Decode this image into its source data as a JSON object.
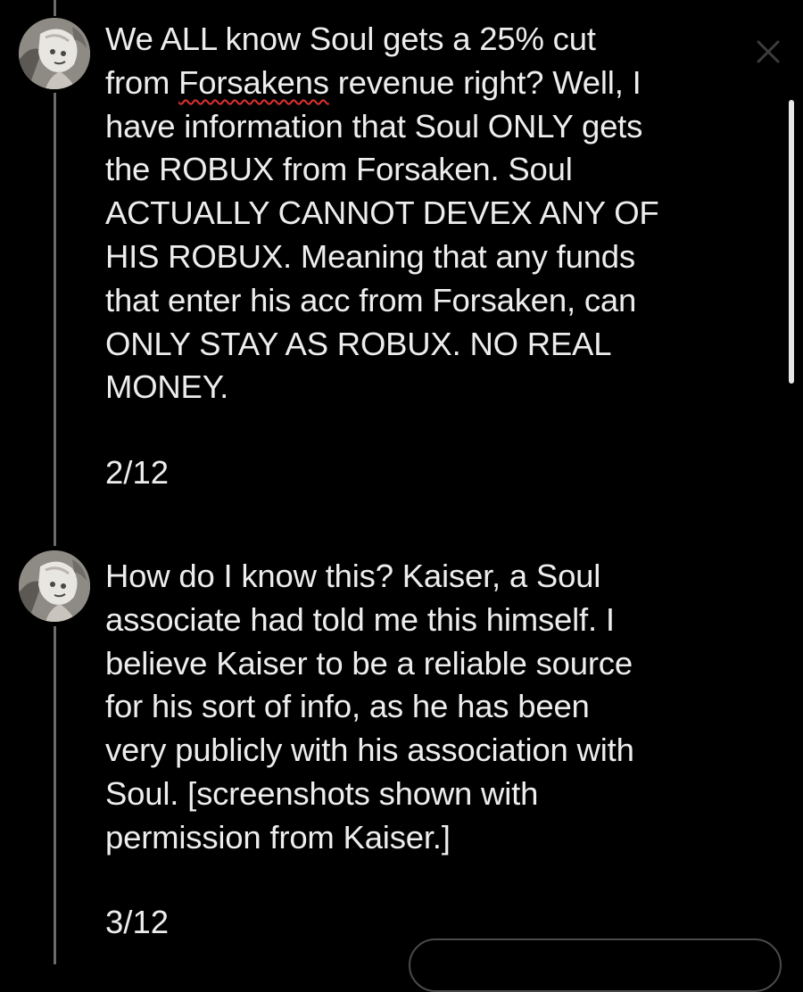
{
  "thread": {
    "posts": [
      {
        "avatar_icon": "user-avatar-icon",
        "text_before": "We ALL know Soul gets a 25% cut\nfrom ",
        "misspelled_word": "Forsakens",
        "text_after": " revenue right? Well, I\nhave information that Soul ONLY gets\nthe ROBUX from Forsaken. Soul\nACTUALLY CANNOT DEVEX ANY OF\nHIS ROBUX. Meaning that any funds\nthat enter his acc from Forsaken, can\nONLY STAY AS ROBUX. NO REAL\nMONEY.",
        "counter": "2/12"
      },
      {
        "avatar_icon": "user-avatar-icon",
        "text": "How do I know this? Kaiser, a Soul\nassociate had told me this himself. I\nbelieve Kaiser to be a reliable source\nfor his sort of info, as he has been\nvery publicly with his association with\nSoul. [screenshots shown with\npermission from Kaiser.]",
        "counter": "3/12"
      }
    ]
  },
  "controls": {
    "close_icon": "close-icon"
  },
  "colors": {
    "background": "#000000",
    "text": "#ededed",
    "thread_line": "#6b6b6b",
    "spellcheck_underline": "#e03131",
    "scrollbar": "#e6e6e6"
  }
}
